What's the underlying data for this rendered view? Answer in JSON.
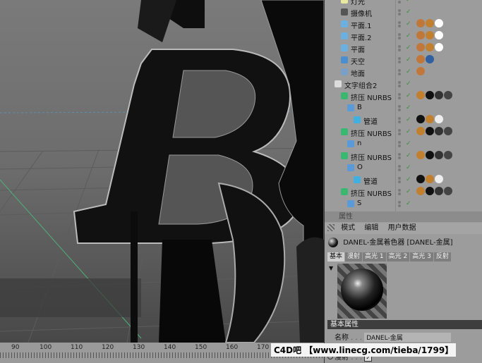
{
  "object_manager": {
    "rows": [
      {
        "label": "灯光",
        "indent": 1,
        "icon": "light-icon"
      },
      {
        "label": "摄像机",
        "indent": 1,
        "icon": "camera-icon"
      },
      {
        "label": "平面.1",
        "indent": 1,
        "icon": "plane-icon"
      },
      {
        "label": "平面.2",
        "indent": 1,
        "icon": "plane-icon"
      },
      {
        "label": "平面",
        "indent": 1,
        "icon": "plane-icon"
      },
      {
        "label": "天空",
        "indent": 1,
        "icon": "sky-icon"
      },
      {
        "label": "地面",
        "indent": 1,
        "icon": "floor-icon"
      },
      {
        "label": "文字组合2",
        "indent": 0,
        "icon": "null-icon"
      },
      {
        "label": "挤压 NURBS",
        "indent": 1,
        "icon": "extrude-icon"
      },
      {
        "label": "B",
        "indent": 2,
        "icon": "spline-icon"
      },
      {
        "label": "管道",
        "indent": 3,
        "icon": "sweep-icon"
      },
      {
        "label": "挤压 NURBS",
        "indent": 1,
        "icon": "extrude-icon"
      },
      {
        "label": "n",
        "indent": 2,
        "icon": "spline-icon"
      },
      {
        "label": "挤压 NURBS",
        "indent": 1,
        "icon": "extrude-icon"
      },
      {
        "label": "O",
        "indent": 2,
        "icon": "spline-icon"
      },
      {
        "label": "管道",
        "indent": 3,
        "icon": "sweep-icon"
      },
      {
        "label": "挤压 NURBS",
        "indent": 1,
        "icon": "extrude-icon"
      },
      {
        "label": "S",
        "indent": 2,
        "icon": "spline-icon"
      }
    ]
  },
  "attributes": {
    "header": "属性",
    "menu": [
      "模式",
      "编辑",
      "用户数据"
    ],
    "material_title": "DANEL-金属着色器 [DANEL-金属]",
    "tabs": [
      "基本",
      "漫射",
      "高光 1",
      "高光 2",
      "高光 3",
      "反射"
    ],
    "active_tab": "基本",
    "section": "基本属性",
    "name_label": "名称",
    "name_value": "DANEL-金属",
    "diffuse_label": "漫射"
  },
  "timeline": {
    "ticks": [
      "90",
      "100",
      "110",
      "120",
      "130",
      "140",
      "150",
      "160",
      "170"
    ]
  },
  "watermark": "C4D吧 【www.linecg.com/tieba/1799】",
  "colors": {
    "accent": "#cc6a18",
    "panel": "#9c9c9c"
  }
}
